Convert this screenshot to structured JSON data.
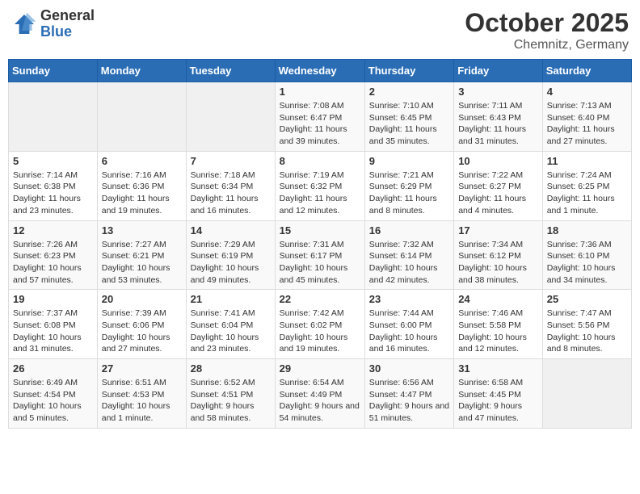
{
  "logo": {
    "general": "General",
    "blue": "Blue"
  },
  "header": {
    "month": "October 2025",
    "location": "Chemnitz, Germany"
  },
  "days_of_week": [
    "Sunday",
    "Monday",
    "Tuesday",
    "Wednesday",
    "Thursday",
    "Friday",
    "Saturday"
  ],
  "weeks": [
    [
      {
        "day": "",
        "empty": true
      },
      {
        "day": "",
        "empty": true
      },
      {
        "day": "",
        "empty": true
      },
      {
        "day": "1",
        "sunrise": "7:08 AM",
        "sunset": "6:47 PM",
        "daylight": "11 hours and 39 minutes."
      },
      {
        "day": "2",
        "sunrise": "7:10 AM",
        "sunset": "6:45 PM",
        "daylight": "11 hours and 35 minutes."
      },
      {
        "day": "3",
        "sunrise": "7:11 AM",
        "sunset": "6:43 PM",
        "daylight": "11 hours and 31 minutes."
      },
      {
        "day": "4",
        "sunrise": "7:13 AM",
        "sunset": "6:40 PM",
        "daylight": "11 hours and 27 minutes."
      }
    ],
    [
      {
        "day": "5",
        "sunrise": "7:14 AM",
        "sunset": "6:38 PM",
        "daylight": "11 hours and 23 minutes."
      },
      {
        "day": "6",
        "sunrise": "7:16 AM",
        "sunset": "6:36 PM",
        "daylight": "11 hours and 19 minutes."
      },
      {
        "day": "7",
        "sunrise": "7:18 AM",
        "sunset": "6:34 PM",
        "daylight": "11 hours and 16 minutes."
      },
      {
        "day": "8",
        "sunrise": "7:19 AM",
        "sunset": "6:32 PM",
        "daylight": "11 hours and 12 minutes."
      },
      {
        "day": "9",
        "sunrise": "7:21 AM",
        "sunset": "6:29 PM",
        "daylight": "11 hours and 8 minutes."
      },
      {
        "day": "10",
        "sunrise": "7:22 AM",
        "sunset": "6:27 PM",
        "daylight": "11 hours and 4 minutes."
      },
      {
        "day": "11",
        "sunrise": "7:24 AM",
        "sunset": "6:25 PM",
        "daylight": "11 hours and 1 minute."
      }
    ],
    [
      {
        "day": "12",
        "sunrise": "7:26 AM",
        "sunset": "6:23 PM",
        "daylight": "10 hours and 57 minutes."
      },
      {
        "day": "13",
        "sunrise": "7:27 AM",
        "sunset": "6:21 PM",
        "daylight": "10 hours and 53 minutes."
      },
      {
        "day": "14",
        "sunrise": "7:29 AM",
        "sunset": "6:19 PM",
        "daylight": "10 hours and 49 minutes."
      },
      {
        "day": "15",
        "sunrise": "7:31 AM",
        "sunset": "6:17 PM",
        "daylight": "10 hours and 45 minutes."
      },
      {
        "day": "16",
        "sunrise": "7:32 AM",
        "sunset": "6:14 PM",
        "daylight": "10 hours and 42 minutes."
      },
      {
        "day": "17",
        "sunrise": "7:34 AM",
        "sunset": "6:12 PM",
        "daylight": "10 hours and 38 minutes."
      },
      {
        "day": "18",
        "sunrise": "7:36 AM",
        "sunset": "6:10 PM",
        "daylight": "10 hours and 34 minutes."
      }
    ],
    [
      {
        "day": "19",
        "sunrise": "7:37 AM",
        "sunset": "6:08 PM",
        "daylight": "10 hours and 31 minutes."
      },
      {
        "day": "20",
        "sunrise": "7:39 AM",
        "sunset": "6:06 PM",
        "daylight": "10 hours and 27 minutes."
      },
      {
        "day": "21",
        "sunrise": "7:41 AM",
        "sunset": "6:04 PM",
        "daylight": "10 hours and 23 minutes."
      },
      {
        "day": "22",
        "sunrise": "7:42 AM",
        "sunset": "6:02 PM",
        "daylight": "10 hours and 19 minutes."
      },
      {
        "day": "23",
        "sunrise": "7:44 AM",
        "sunset": "6:00 PM",
        "daylight": "10 hours and 16 minutes."
      },
      {
        "day": "24",
        "sunrise": "7:46 AM",
        "sunset": "5:58 PM",
        "daylight": "10 hours and 12 minutes."
      },
      {
        "day": "25",
        "sunrise": "7:47 AM",
        "sunset": "5:56 PM",
        "daylight": "10 hours and 8 minutes."
      }
    ],
    [
      {
        "day": "26",
        "sunrise": "6:49 AM",
        "sunset": "4:54 PM",
        "daylight": "10 hours and 5 minutes."
      },
      {
        "day": "27",
        "sunrise": "6:51 AM",
        "sunset": "4:53 PM",
        "daylight": "10 hours and 1 minute."
      },
      {
        "day": "28",
        "sunrise": "6:52 AM",
        "sunset": "4:51 PM",
        "daylight": "9 hours and 58 minutes."
      },
      {
        "day": "29",
        "sunrise": "6:54 AM",
        "sunset": "4:49 PM",
        "daylight": "9 hours and 54 minutes."
      },
      {
        "day": "30",
        "sunrise": "6:56 AM",
        "sunset": "4:47 PM",
        "daylight": "9 hours and 51 minutes."
      },
      {
        "day": "31",
        "sunrise": "6:58 AM",
        "sunset": "4:45 PM",
        "daylight": "9 hours and 47 minutes."
      },
      {
        "day": "",
        "empty": true
      }
    ]
  ]
}
